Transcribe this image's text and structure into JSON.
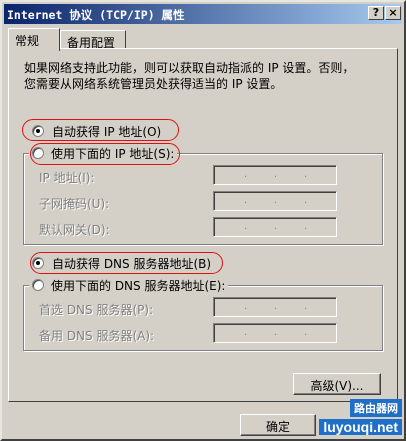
{
  "window": {
    "title": "Internet 协议 (TCP/IP) 属性",
    "help_btn": "?",
    "close_btn": "×"
  },
  "tabs": [
    {
      "label": "常规"
    },
    {
      "label": "备用配置"
    }
  ],
  "description": {
    "line1": "如果网络支持此功能，则可以获取自动指派的 IP 设置。否则，",
    "line2": "您需要从网络系统管理员处获得适当的 IP 设置。"
  },
  "ip_section": {
    "auto_label": "自动获得 IP 地址(O)",
    "manual_label": "使用下面的 IP 地址(S):",
    "selected": "auto",
    "fields": [
      {
        "label": "IP 地址(I):"
      },
      {
        "label": "子网掩码(U):"
      },
      {
        "label": "默认网关(D):"
      }
    ]
  },
  "dns_section": {
    "auto_label": "自动获得 DNS 服务器地址(B)",
    "manual_label": "使用下面的 DNS 服务器地址(E):",
    "selected": "auto",
    "fields": [
      {
        "label": "首选 DNS 服务器(P):"
      },
      {
        "label": "备用 DNS 服务器(A):"
      }
    ]
  },
  "buttons": {
    "advanced": "高级(V)...",
    "ok": "确定"
  },
  "watermark": {
    "line1": "路由器网",
    "line2": "luyouqi.net"
  },
  "colors": {
    "highlight_oval": "#e01010",
    "title_gradient_start": "#0a246a"
  }
}
